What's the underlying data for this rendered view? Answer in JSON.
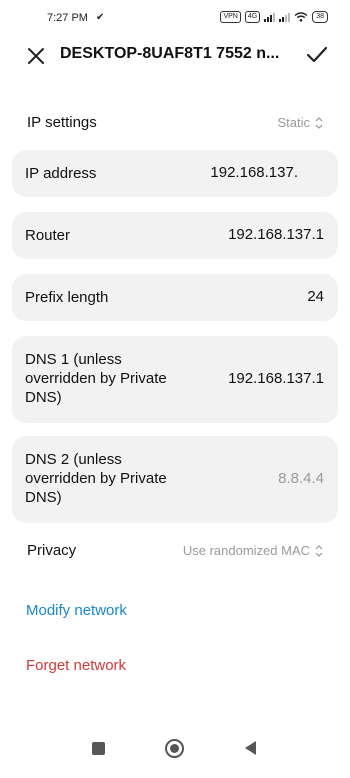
{
  "status_bar": {
    "time": "7:27 PM",
    "carrier_glyph": "✔",
    "vpn_badge": "VPN",
    "lte_badge": "4G",
    "battery": "38"
  },
  "header": {
    "title": "DESKTOP-8UAF8T1 7552 n..."
  },
  "ip_settings": {
    "label": "IP settings",
    "value": "Static"
  },
  "fields": [
    {
      "label": "IP address",
      "value": "192.168.137."
    },
    {
      "label": "Router",
      "value": "192.168.137.1"
    },
    {
      "label": "Prefix length",
      "value": "24"
    },
    {
      "label_lines": [
        "DNS 1 (unless",
        "overridden by Private",
        "DNS)"
      ],
      "value": "192.168.137.1"
    },
    {
      "label_lines": [
        "DNS 2 (unless",
        "overridden by Private",
        "DNS)"
      ],
      "value": "8.8.4.4"
    }
  ],
  "privacy": {
    "label": "Privacy",
    "value": "Use randomized MAC"
  },
  "actions": {
    "modify": "Modify network",
    "forget": "Forget network"
  },
  "colors": {
    "link_blue": "#1a87c9",
    "danger_red": "#d43a3a",
    "card_bg": "#f2f2f2"
  }
}
